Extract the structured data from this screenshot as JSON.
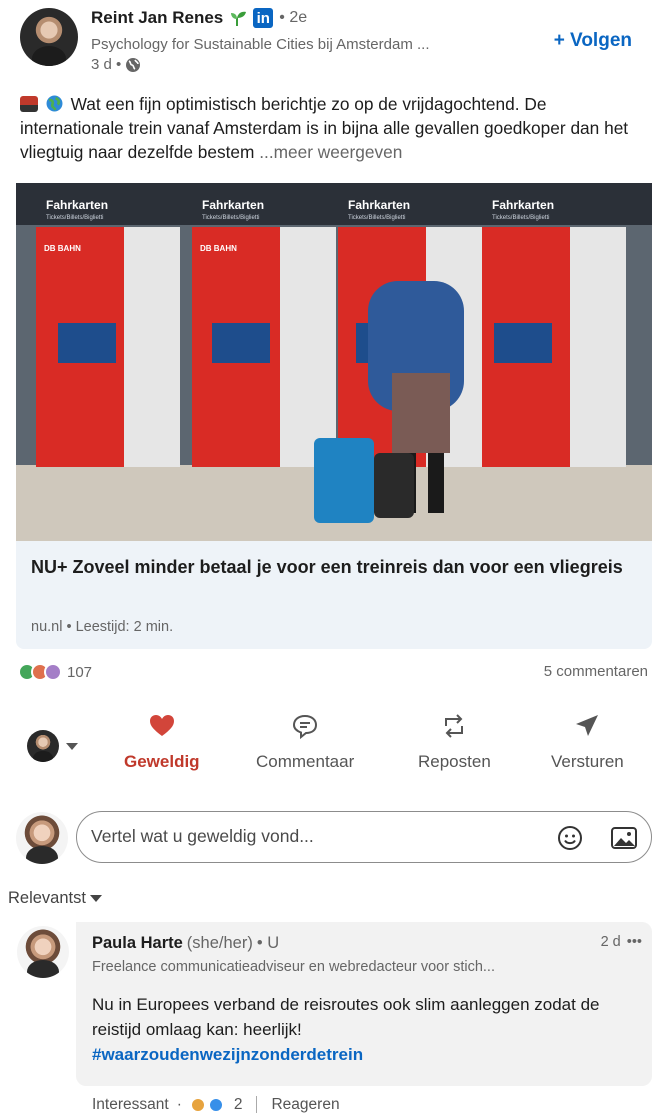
{
  "post": {
    "author_name": "Reint Jan Renes",
    "connection_degree": "• 2e",
    "li_badge": "in",
    "headline": "Psychology for Sustainable Cities bij Amsterdam ...",
    "time": "3 d •",
    "follow_label": "+ Volgen",
    "text": "Wat een fijn optimistisch berichtje zo op de vrijdagochtend. De internationale trein vanaf Amsterdam is in bijna alle gevallen goedkoper dan het vliegtuig naar dezelfde bestem",
    "see_more": "...meer weergeven"
  },
  "article": {
    "title": "NU+ Zoveel minder betaal je voor een treinreis dan voor een vliegreis",
    "source": "nu.nl • Leestijd: 2 min.",
    "image_signs": [
      "Fahrkarten",
      "Fahrkarten",
      "Fahrkarten",
      "Fahrkarten"
    ],
    "image_sub": "Tickets/Billets/Biglietti",
    "image_brand": "DB BAHN"
  },
  "social": {
    "reactions_count": "107",
    "comments_count": "5 commentaren"
  },
  "actions": {
    "like": "Geweldig",
    "comment": "Commentaar",
    "repost": "Reposten",
    "send": "Versturen"
  },
  "comment_box": {
    "placeholder": "Vertel wat u geweldig vond..."
  },
  "sort": {
    "label": "Relevantst"
  },
  "comment": {
    "name": "Paula Harte",
    "pronoun": "(she/her)",
    "degree": "• U",
    "time": "2 d",
    "more": "•••",
    "headline": "Freelance communicatieadviseur en webredacteur voor stich...",
    "text": "Nu in Europees verband de reisroutes ook slim aanleggen zodat de reistijd omlaag kan: heerlijk!",
    "hashtag": "#waarzoudenwezijnzonderdetrein",
    "reaction_label": "Interessant",
    "reaction_dot": "·",
    "reaction_count": "2",
    "reply_label": "Reageren"
  },
  "colors": {
    "brand": "#0a66c2",
    "like": "#c0392b",
    "card_bg": "#eef3f8"
  }
}
